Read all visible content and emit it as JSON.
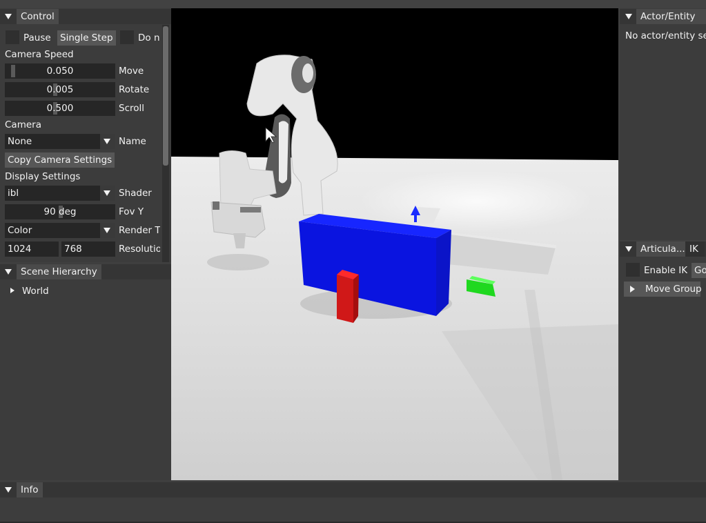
{
  "control": {
    "title": "Control",
    "pause_label": "Pause",
    "single_step_label": "Single Step",
    "do_label": "Do n",
    "camera_speed_label": "Camera Speed",
    "move_value": "0.050",
    "move_label": "Move",
    "rotate_value": "0.005",
    "rotate_label": "Rotate",
    "scroll_value": "0.500",
    "scroll_label": "Scroll",
    "camera_label": "Camera",
    "camera_name_value": "None",
    "camera_name_label": "Name",
    "copy_camera_label": "Copy Camera Settings",
    "display_settings_label": "Display Settings",
    "shader_value": "ibl",
    "shader_label": "Shader",
    "fovy_value": "90 deg",
    "fovy_label": "Fov Y",
    "render_target_value": "Color",
    "render_target_label": "Render T",
    "resolution_w": "1024",
    "resolution_h": "768",
    "resolution_label": "Resolutio"
  },
  "scene_hierarchy": {
    "title": "Scene Hierarchy",
    "root_label": "World"
  },
  "actor_entity": {
    "title": "Actor/Entity",
    "empty_text": "No actor/entity se"
  },
  "articulation": {
    "tab_label": "Articula...",
    "ik_tab_label": "IK",
    "enable_ik_label": "Enable IK",
    "go_label": "Go",
    "move_group_label": "Move Group"
  },
  "info": {
    "title": "Info"
  },
  "colors": {
    "window_bg": "#3c3c3c",
    "header_bg": "#353535",
    "blue_box": "#0a14e0",
    "red_block": "#d01818",
    "green_block": "#1fd81f"
  },
  "icons": [
    "collapse-triangle-icon",
    "expand-triangle-icon",
    "combo-arrow-icon",
    "mouse-cursor-icon"
  ]
}
